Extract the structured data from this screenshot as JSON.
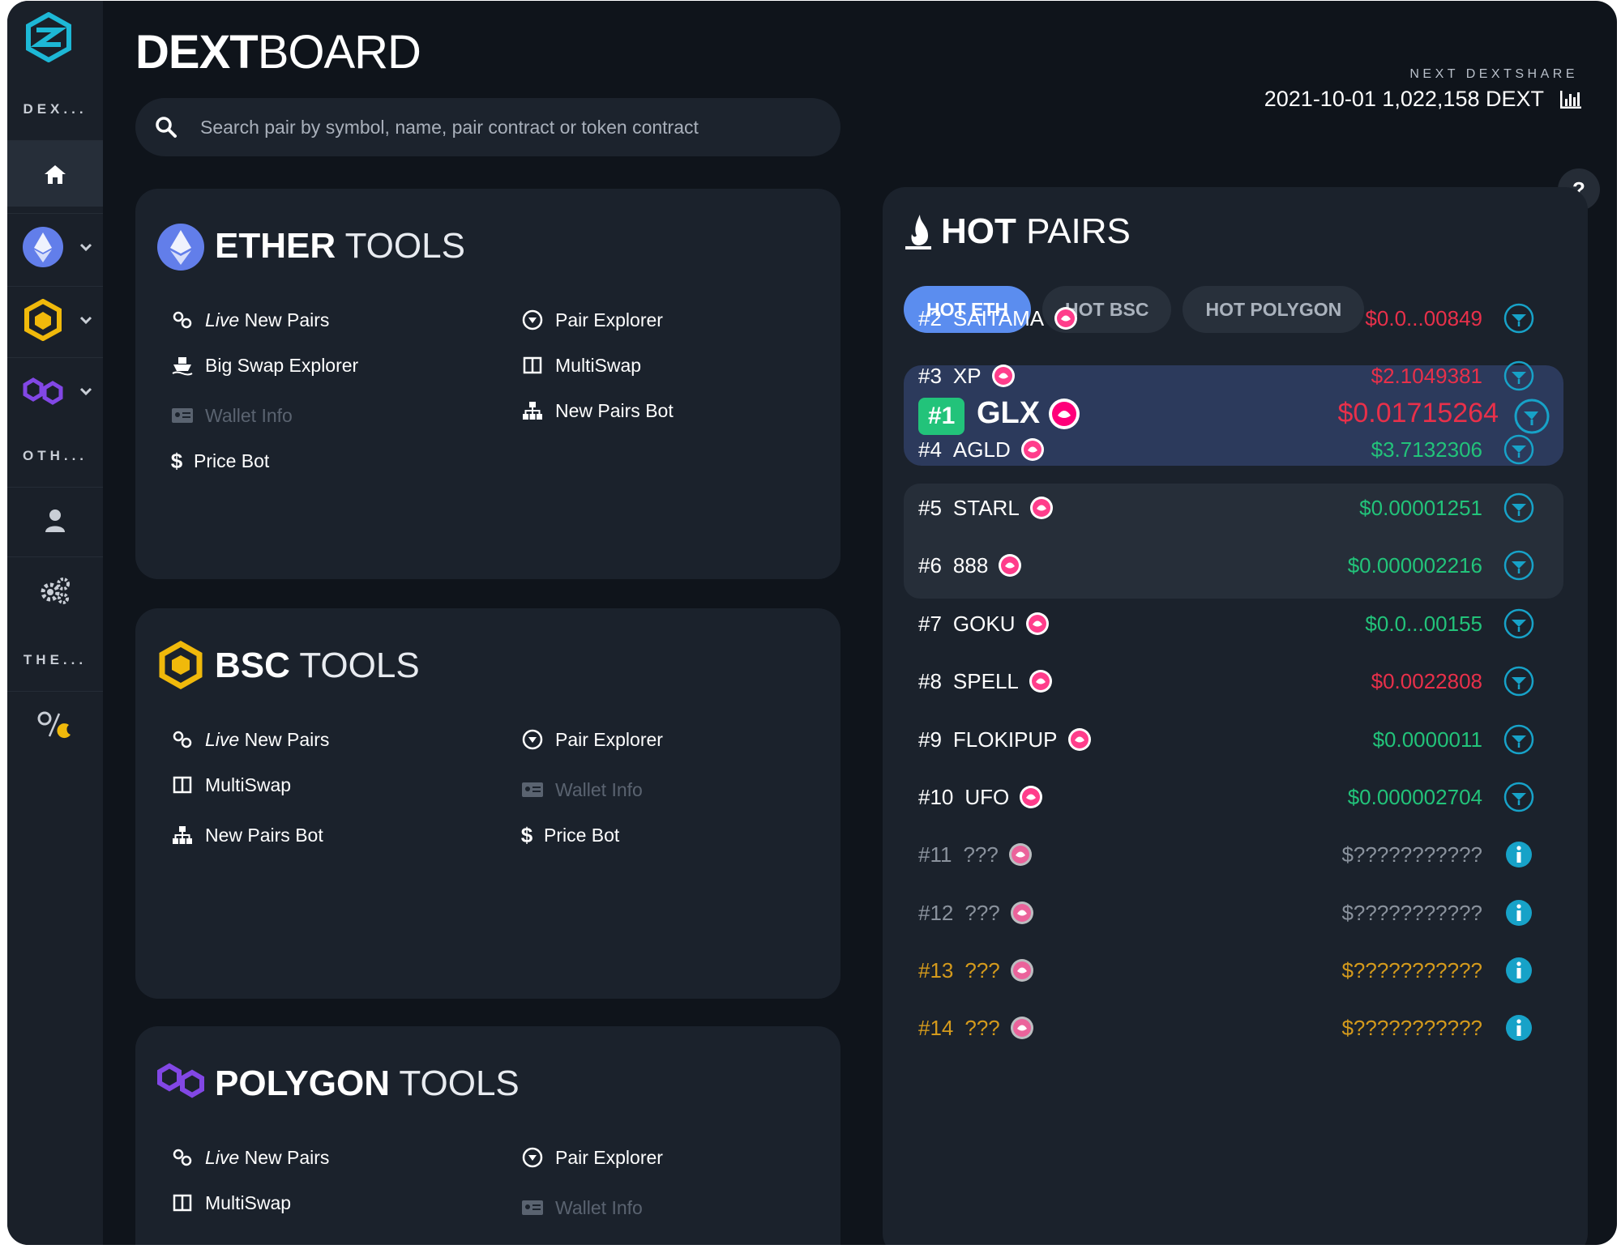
{
  "brand": {
    "bold": "DEXT",
    "light": "BOARD"
  },
  "search": {
    "placeholder": "Search pair by symbol, name, pair contract or token contract"
  },
  "next_dextshare": {
    "label": "NEXT DEXTSHARE",
    "value": "2021-10-01 1,022,158 DEXT"
  },
  "sidebar": {
    "section_dex": "DEX...",
    "section_other": "OTH...",
    "section_theme": "THE..."
  },
  "help_label": "?",
  "ether_tools": {
    "title_bold": "ETHER",
    "title_light": "TOOLS",
    "live_word": "Live",
    "live_rest": "New Pairs",
    "pair_explorer": "Pair Explorer",
    "big_swap": "Big Swap Explorer",
    "multiswap": "MultiSwap",
    "wallet_info": "Wallet Info",
    "new_pairs_bot": "New Pairs Bot",
    "price_bot": "Price Bot"
  },
  "bsc_tools": {
    "title_bold": "BSC",
    "title_light": "TOOLS",
    "live_word": "Live",
    "live_rest": "New Pairs",
    "pair_explorer": "Pair Explorer",
    "multiswap": "MultiSwap",
    "wallet_info": "Wallet Info",
    "new_pairs_bot": "New Pairs Bot",
    "price_bot": "Price Bot"
  },
  "polygon_tools": {
    "title_bold": "POLYGON",
    "title_light": "TOOLS",
    "live_word": "Live",
    "live_rest": "New Pairs",
    "pair_explorer": "Pair Explorer",
    "multiswap": "MultiSwap",
    "wallet_info": "Wallet Info"
  },
  "hot_pairs": {
    "title_bold": "HOT",
    "title_light": "PAIRS",
    "tabs": [
      "HOT ETH",
      "HOT BSC",
      "HOT POLYGON"
    ],
    "active_tab": "HOT ETH",
    "top": {
      "rank": "#1",
      "symbol": "GLX",
      "price": "$0.01715264"
    },
    "rows": [
      {
        "rank": "#2",
        "symbol": "SAITAMA",
        "price": "$0.0...00849",
        "trend": "down"
      },
      {
        "rank": "#3",
        "symbol": "XP",
        "price": "$2.1049381",
        "trend": "down"
      },
      {
        "rank": "#4",
        "symbol": "AGLD",
        "price": "$3.7132306",
        "trend": "up"
      },
      {
        "rank": "#5",
        "symbol": "STARL",
        "price": "$0.00001251",
        "trend": "up"
      },
      {
        "rank": "#6",
        "symbol": "888",
        "price": "$0.000002216",
        "trend": "up"
      },
      {
        "rank": "#7",
        "symbol": "GOKU",
        "price": "$0.0...00155",
        "trend": "up"
      },
      {
        "rank": "#8",
        "symbol": "SPELL",
        "price": "$0.0022808",
        "trend": "down"
      },
      {
        "rank": "#9",
        "symbol": "FLOKIPUP",
        "price": "$0.0000011",
        "trend": "up"
      },
      {
        "rank": "#10",
        "symbol": "UFO",
        "price": "$0.000002704",
        "trend": "up"
      },
      {
        "rank": "#11",
        "symbol": "???",
        "price": "$???????????",
        "trend": "hidden"
      },
      {
        "rank": "#12",
        "symbol": "???",
        "price": "$???????????",
        "trend": "hidden"
      },
      {
        "rank": "#13",
        "symbol": "???",
        "price": "$???????????",
        "trend": "gold"
      },
      {
        "rank": "#14",
        "symbol": "???",
        "price": "$???????????",
        "trend": "gold"
      }
    ]
  },
  "colors": {
    "accent": "#5b8def",
    "up": "#22c37a",
    "down": "#e8304a",
    "gold": "#d49a1c",
    "teal": "#17a2c8"
  }
}
